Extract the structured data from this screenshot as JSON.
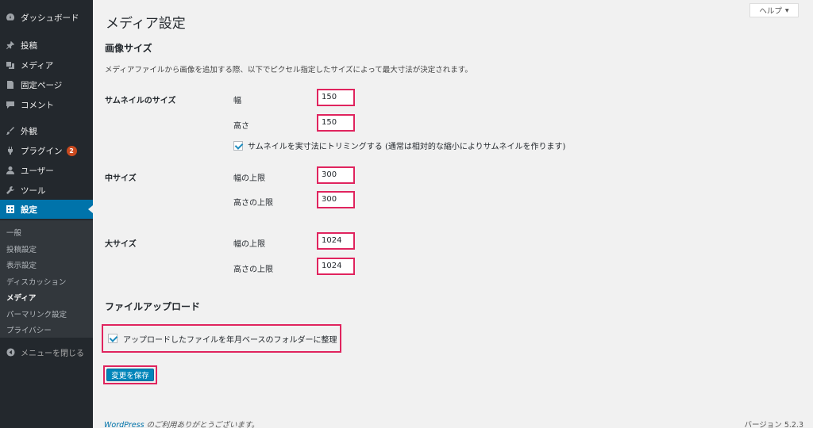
{
  "sidebar": {
    "items": [
      {
        "label": "ダッシュボード",
        "icon": "dashboard-icon"
      },
      {
        "label": "投稿",
        "icon": "pin-icon"
      },
      {
        "label": "メディア",
        "icon": "media-icon"
      },
      {
        "label": "固定ページ",
        "icon": "page-icon"
      },
      {
        "label": "コメント",
        "icon": "comment-icon"
      },
      {
        "label": "外観",
        "icon": "brush-icon"
      },
      {
        "label": "プラグイン",
        "icon": "plugin-icon",
        "badge": "2"
      },
      {
        "label": "ユーザー",
        "icon": "user-icon"
      },
      {
        "label": "ツール",
        "icon": "wrench-icon"
      },
      {
        "label": "設定",
        "icon": "settings-icon"
      }
    ],
    "submenu": [
      "一般",
      "投稿設定",
      "表示設定",
      "ディスカッション",
      "メディア",
      "パーマリンク設定",
      "プライバシー"
    ],
    "collapse_label": "メニューを閉じる"
  },
  "main": {
    "help_label": "ヘルプ",
    "title": "メディア設定",
    "image_sizes": {
      "heading": "画像サイズ",
      "description": "メディアファイルから画像を追加する際、以下でピクセル指定したサイズによって最大寸法が決定されます。",
      "thumbnail": {
        "label": "サムネイルのサイズ",
        "width_label": "幅",
        "width": "150",
        "height_label": "高さ",
        "height": "150",
        "crop_label": "サムネイルを実寸法にトリミングする (通常は相対的な縮小によりサムネイルを作ります)"
      },
      "medium": {
        "label": "中サイズ",
        "width_label": "幅の上限",
        "width": "300",
        "height_label": "高さの上限",
        "height": "300"
      },
      "large": {
        "label": "大サイズ",
        "width_label": "幅の上限",
        "width": "1024",
        "height_label": "高さの上限",
        "height": "1024"
      }
    },
    "uploads": {
      "heading": "ファイルアップロード",
      "organize_label": "アップロードしたファイルを年月ベースのフォルダーに整理"
    },
    "save_label": "変更を保存"
  },
  "footer": {
    "link": "WordPress",
    "thanks": " のご利用ありがとうございます。",
    "version": "バージョン 5.2.3"
  },
  "colors": {
    "sidebar_bg": "#23282d",
    "submenu_bg": "#32373c",
    "active": "#0073aa",
    "highlight_border": "#e0245e",
    "badge": "#ca4a1f"
  }
}
